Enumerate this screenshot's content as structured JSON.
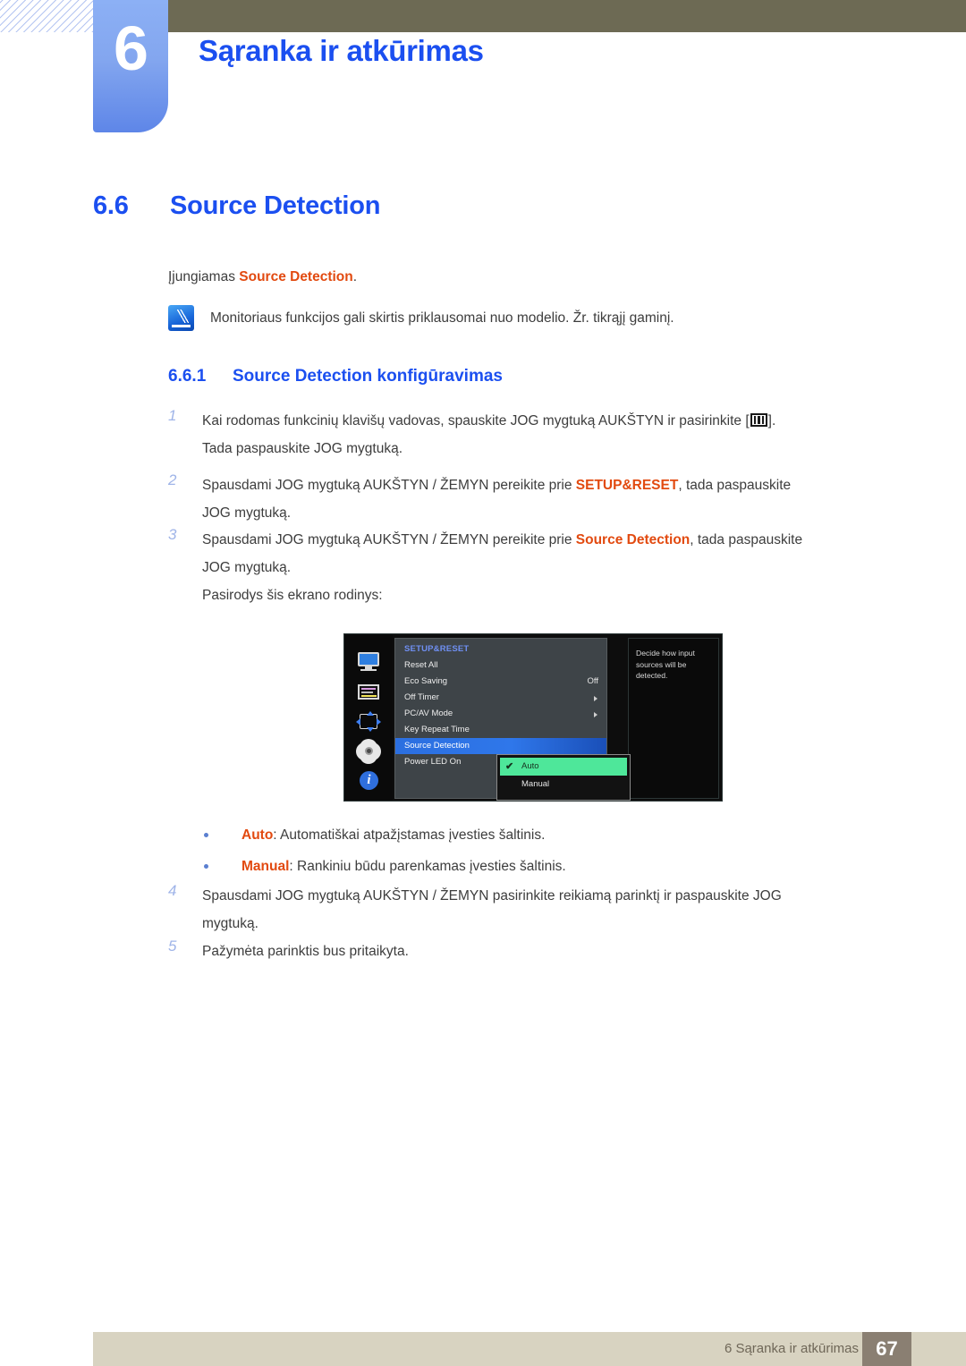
{
  "chapter": {
    "number": "6",
    "title": "Sąranka ir atkūrimas"
  },
  "section": {
    "number": "6.6",
    "title": "Source Detection",
    "intro_prefix": "Įjungiamas ",
    "intro_highlight": "Source Detection",
    "intro_suffix": ".",
    "note": "Monitoriaus funkcijos gali skirtis priklausomai nuo modelio. Žr. tikrąjį gaminį."
  },
  "subsection": {
    "number": "6.6.1",
    "title": "Source Detection konfigūravimas"
  },
  "steps": [
    {
      "num": "1",
      "line1_a": "Kai rodomas funkcinių klavišų vadovas, spauskite JOG mygtuką AUKŠTYN ir pasirinkite [",
      "line1_b": "].",
      "line2": "Tada paspauskite JOG mygtuką."
    },
    {
      "num": "2",
      "line1_a": "Spausdami JOG mygtuką AUKŠTYN / ŽEMYN pereikite prie ",
      "highlight": "SETUP&RESET",
      "line1_b": ", tada paspauskite",
      "line2": "JOG mygtuką."
    },
    {
      "num": "3",
      "line1_a": "Spausdami JOG mygtuką AUKŠTYN / ŽEMYN pereikite prie ",
      "highlight": "Source Detection",
      "line1_b": ", tada paspauskite",
      "line2": "JOG mygtuką.",
      "line3": "Pasirodys šis ekrano rodinys:"
    },
    {
      "num": "4",
      "line1": "Spausdami JOG mygtuką AUKŠTYN / ŽEMYN pasirinkite reikiamą parinktį ir paspauskite JOG",
      "line2": "mygtuką."
    },
    {
      "num": "5",
      "line1": "Pažymėta parinktis bus pritaikyta."
    }
  ],
  "bullets": [
    {
      "term": "Auto",
      "desc": ": Automatiškai atpažįstamas įvesties šaltinis."
    },
    {
      "term": "Manual",
      "desc": ": Rankiniu būdu parenkamas įvesties šaltinis."
    }
  ],
  "osd": {
    "sidebar_icons": [
      "monitor-icon",
      "picture-bars-icon",
      "screen-adjust-icon",
      "gear-icon",
      "info-icon"
    ],
    "category": "SETUP&RESET",
    "items": [
      {
        "label": "Reset All",
        "value": "",
        "arrow": false,
        "selected": false
      },
      {
        "label": "Eco Saving",
        "value": "Off",
        "arrow": false,
        "selected": false
      },
      {
        "label": "Off Timer",
        "value": "",
        "arrow": true,
        "selected": false
      },
      {
        "label": "PC/AV Mode",
        "value": "",
        "arrow": true,
        "selected": false
      },
      {
        "label": "Key Repeat Time",
        "value": "",
        "arrow": false,
        "selected": false
      },
      {
        "label": "Source Detection",
        "value": "",
        "arrow": false,
        "selected": true
      },
      {
        "label": "Power LED On",
        "value": "",
        "arrow": false,
        "selected": false
      }
    ],
    "submenu": [
      {
        "label": "Auto",
        "checked": true
      },
      {
        "label": "Manual",
        "checked": false
      }
    ],
    "check_glyph": "✔",
    "help_text": "Decide how input sources will be detected."
  },
  "footer": {
    "text": "6 Sąranka ir atkūrimas",
    "page": "67"
  },
  "colors": {
    "heading_blue": "#1b4ff0",
    "accent_orange": "#e24a10",
    "header_olive": "#6d6a54",
    "footer_beige": "#d8d3c1",
    "footer_page_box": "#8a7f72",
    "osd_selected_blue": "#2f77ea",
    "osd_active_green": "#4ee79a"
  }
}
